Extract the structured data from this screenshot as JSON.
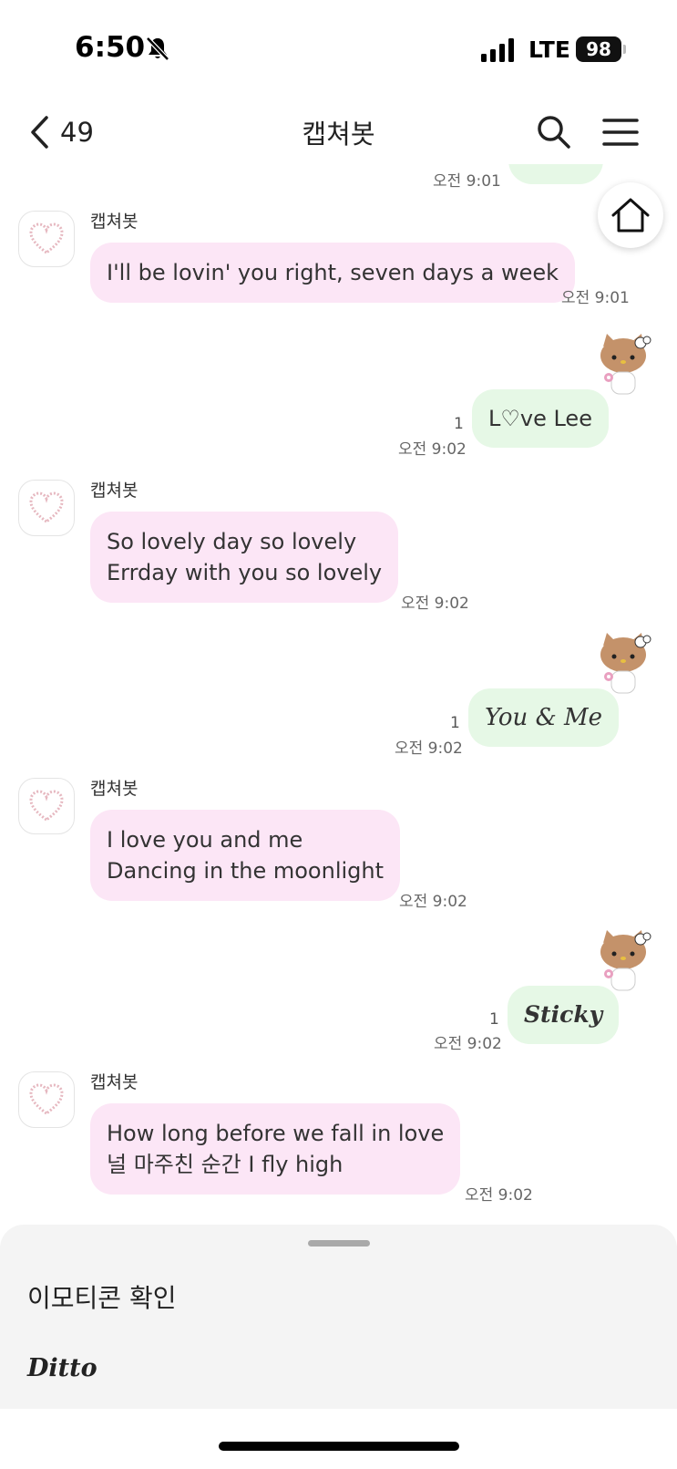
{
  "status_bar": {
    "time": "6:50",
    "carrier": "LTE",
    "battery": "98"
  },
  "header": {
    "back_count": "49",
    "title": "캡쳐봇"
  },
  "chat": {
    "partial_time": "오전 9:01",
    "messages": [
      {
        "sender": "캡쳐봇",
        "lines": [
          "I'll be lovin' you right, seven days a week"
        ],
        "time": "오전 9:01"
      },
      {
        "lines": [
          "L♡ve Lee"
        ],
        "read_count": "1",
        "time": "오전 9:02"
      },
      {
        "sender": "캡쳐봇",
        "lines": [
          "So lovely day so lovely",
          "Errday with you so lovely"
        ],
        "time": "오전 9:02"
      },
      {
        "lines": [
          "You & Me"
        ],
        "read_count": "1",
        "time": "오전 9:02"
      },
      {
        "sender": "캡쳐봇",
        "lines": [
          "I love you and me",
          "Dancing in the moonlight"
        ],
        "time": "오전 9:02"
      },
      {
        "lines": [
          "Sticky"
        ],
        "read_count": "1",
        "time": "오전 9:02"
      },
      {
        "sender": "캡쳐봇",
        "lines": [
          "How long before we fall in love",
          "널 마주친 순간 I fly high"
        ],
        "time": "오전 9:02"
      }
    ]
  },
  "bottom_sheet": {
    "title": "이모티콘 확인",
    "item": "Ditto"
  },
  "colors": {
    "incoming_bubble": "#fce6f6",
    "outgoing_bubble": "#e6f8e6",
    "sheet_bg": "#f4f4f4"
  }
}
